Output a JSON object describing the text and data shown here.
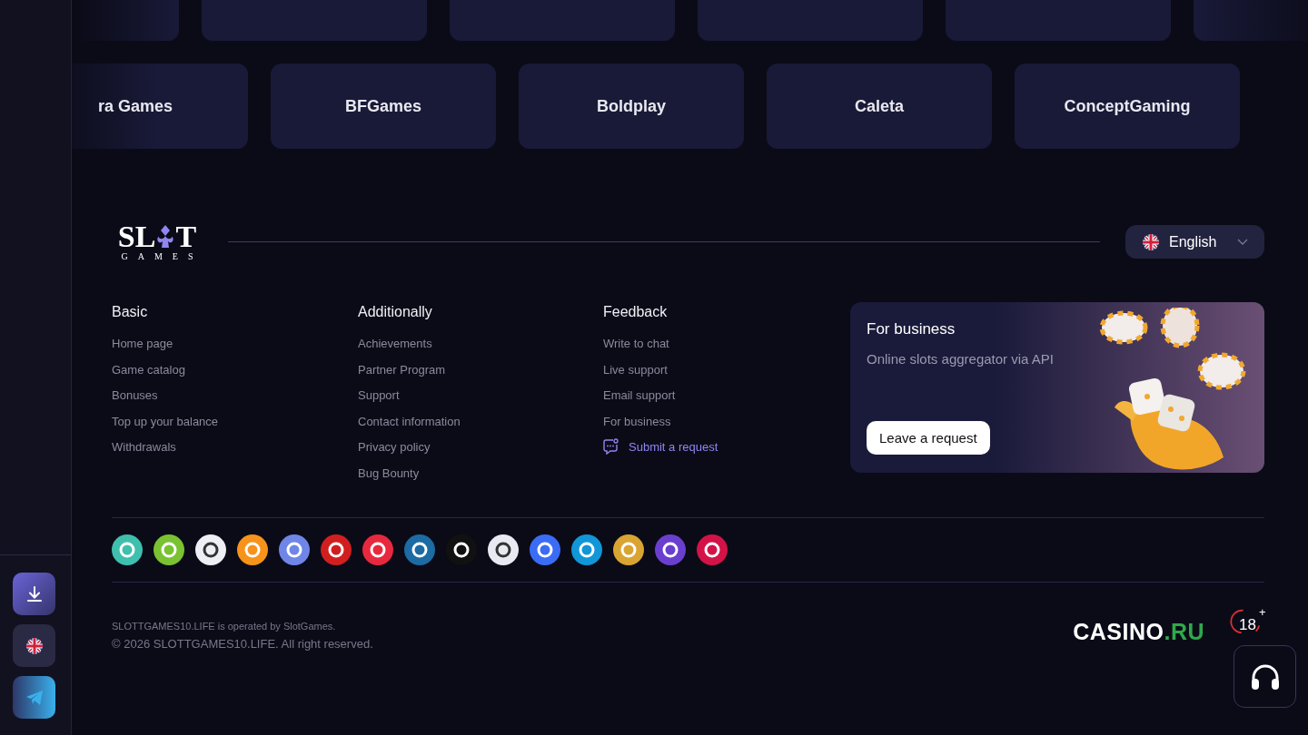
{
  "sidebar": {
    "buttons": [
      {
        "kind": "download"
      },
      {
        "kind": "language"
      },
      {
        "kind": "telegram"
      }
    ]
  },
  "providers": {
    "rows": [
      [
        {
          "kind": "fade-left"
        },
        {
          "kind": "blank"
        },
        {
          "kind": "blank"
        },
        {
          "kind": "blank"
        },
        {
          "kind": "blank"
        },
        {
          "kind": "fade-right"
        }
      ],
      [
        {
          "kind": "name",
          "name": "ra Games"
        },
        {
          "kind": "name",
          "name": "BFGames"
        },
        {
          "kind": "name",
          "name": "Boldplay"
        },
        {
          "kind": "name",
          "name": "Caleta"
        },
        {
          "kind": "name",
          "name": "ConceptGaming"
        }
      ]
    ]
  },
  "logo": {
    "left": "SL",
    "right": "T",
    "bottom": "GAMES"
  },
  "language": {
    "value": "English"
  },
  "columns": [
    {
      "title": "Basic",
      "links": [
        {
          "label": "Home page",
          "kind": "plain"
        },
        {
          "label": "Game catalog",
          "kind": "plain"
        },
        {
          "label": "Bonuses",
          "kind": "plain"
        },
        {
          "label": "Top up your balance",
          "kind": "plain"
        },
        {
          "label": "Withdrawals",
          "kind": "plain"
        }
      ]
    },
    {
      "title": "Additionally",
      "links": [
        {
          "label": "Achievements",
          "kind": "plain"
        },
        {
          "label": "Partner Program",
          "kind": "plain"
        },
        {
          "label": "Support",
          "kind": "plain"
        },
        {
          "label": "Contact information",
          "kind": "plain"
        },
        {
          "label": "Privacy policy",
          "kind": "plain"
        },
        {
          "label": "Bug Bounty",
          "kind": "plain"
        }
      ]
    },
    {
      "title": "Feedback",
      "links": [
        {
          "label": "Write to chat",
          "kind": "plain"
        },
        {
          "label": "Live support",
          "kind": "plain"
        },
        {
          "label": "Email support",
          "kind": "plain"
        },
        {
          "label": "For business",
          "kind": "plain"
        },
        {
          "label": "Submit a request",
          "kind": "request"
        }
      ]
    }
  ],
  "business_card": {
    "title": "For business",
    "subtitle": "Online slots aggregator via API",
    "button": "Leave a request"
  },
  "payments": [
    {
      "color": "#3fbfae"
    },
    {
      "color": "#7ac231"
    },
    {
      "color": "#eeeef5"
    },
    {
      "color": "#f7931a"
    },
    {
      "color": "#6f86e8"
    },
    {
      "color": "#d11f1f"
    },
    {
      "color": "#e8283e"
    },
    {
      "color": "#1c6ba3"
    },
    {
      "color": "#111111"
    },
    {
      "color": "#e9e9f2"
    },
    {
      "color": "#3b6cf6"
    },
    {
      "color": "#1196d8"
    },
    {
      "color": "#d9a431"
    },
    {
      "color": "#6a3fd0"
    },
    {
      "color": "#d31347"
    }
  ],
  "legal": {
    "operator": "SLOTTGAMES10.LIFE is operated by SlotGames.",
    "copyright": "© 2026 SLOTTGAMES10.LIFE. All right reserved."
  },
  "casino_logo": {
    "main": "CASINO",
    "suffix": ".RU"
  },
  "age": {
    "number": "18",
    "plus": "+"
  }
}
